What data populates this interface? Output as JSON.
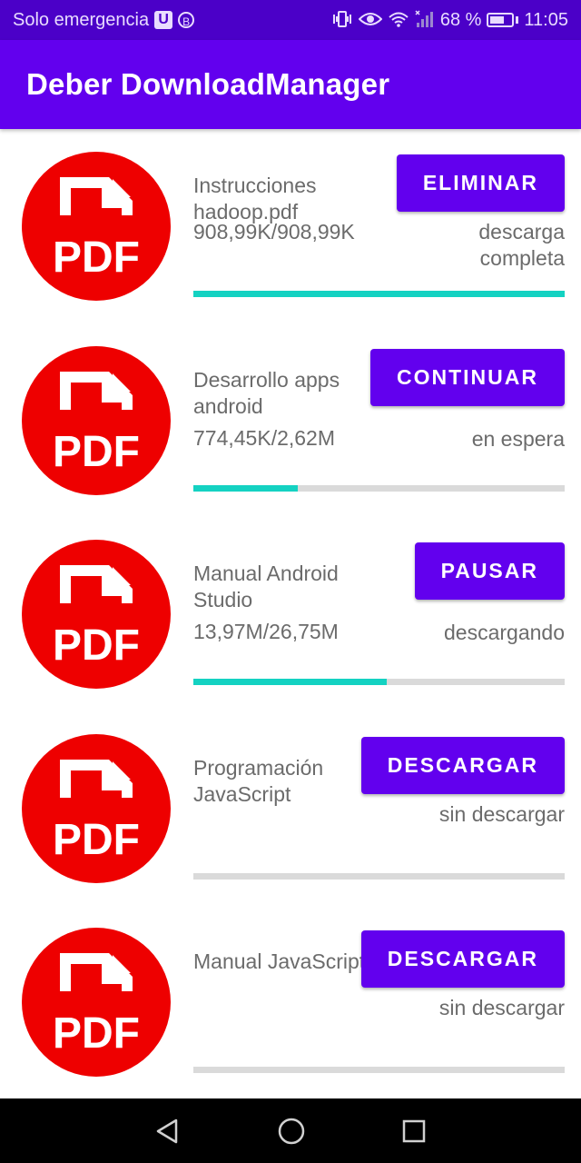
{
  "status_bar": {
    "carrier": "Solo emergencia",
    "battery_percent": "68 %",
    "battery_level": 0.68,
    "time": "11:05"
  },
  "app_bar": {
    "title": "Deber DownloadManager"
  },
  "colors": {
    "primary": "#6200ee",
    "status_bar": "#4b00c8",
    "progress": "#14d2c2",
    "pdf_red": "#ee0000"
  },
  "downloads": [
    {
      "title": "Instrucciones hadoop.pdf",
      "size": "908,99K/908,99K",
      "status": "descarga completa",
      "action": "ELIMINAR",
      "progress": 1.0,
      "icon": "pdf-icon"
    },
    {
      "title": "Desarrollo apps android",
      "size": "774,45K/2,62M",
      "status": "en espera",
      "action": "CONTINUAR",
      "progress": 0.28,
      "icon": "pdf-icon"
    },
    {
      "title": "Manual Android Studio",
      "size": "13,97M/26,75M",
      "status": "descargando",
      "action": "PAUSAR",
      "progress": 0.52,
      "icon": "pdf-icon"
    },
    {
      "title": "Programación JavaScript",
      "size": "",
      "status": "sin descargar",
      "action": "DESCARGAR",
      "progress": 0,
      "icon": "pdf-icon"
    },
    {
      "title": "Manual JavaScript",
      "size": "",
      "status": "sin descargar",
      "action": "DESCARGAR",
      "progress": 0,
      "icon": "pdf-icon"
    }
  ],
  "nav_bar": {
    "icons": [
      "back-icon",
      "home-icon",
      "recents-icon"
    ]
  }
}
